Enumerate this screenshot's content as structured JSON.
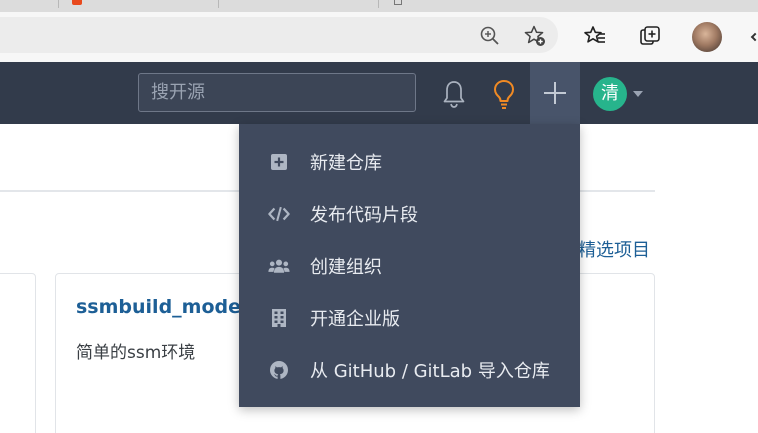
{
  "header": {
    "search_placeholder": "搜开源",
    "user_initial": "清"
  },
  "dropdown": {
    "items": [
      {
        "label": "新建仓库",
        "icon": "plus-square-icon"
      },
      {
        "label": "发布代码片段",
        "icon": "code-icon"
      },
      {
        "label": "创建组织",
        "icon": "users-icon"
      },
      {
        "label": "开通企业版",
        "icon": "building-icon"
      },
      {
        "label": "从 GitHub / GitLab 导入仓库",
        "icon": "github-icon"
      }
    ]
  },
  "main": {
    "featured_link": "精选项目",
    "card": {
      "title": "ssmbuild_model",
      "description": "简单的ssm环境"
    }
  },
  "colors": {
    "header_bg": "#323b4b",
    "menu_bg": "#404a5e",
    "avatar_bg": "#27b48c",
    "lightbulb": "#f08a24",
    "link": "#1d5f96"
  }
}
